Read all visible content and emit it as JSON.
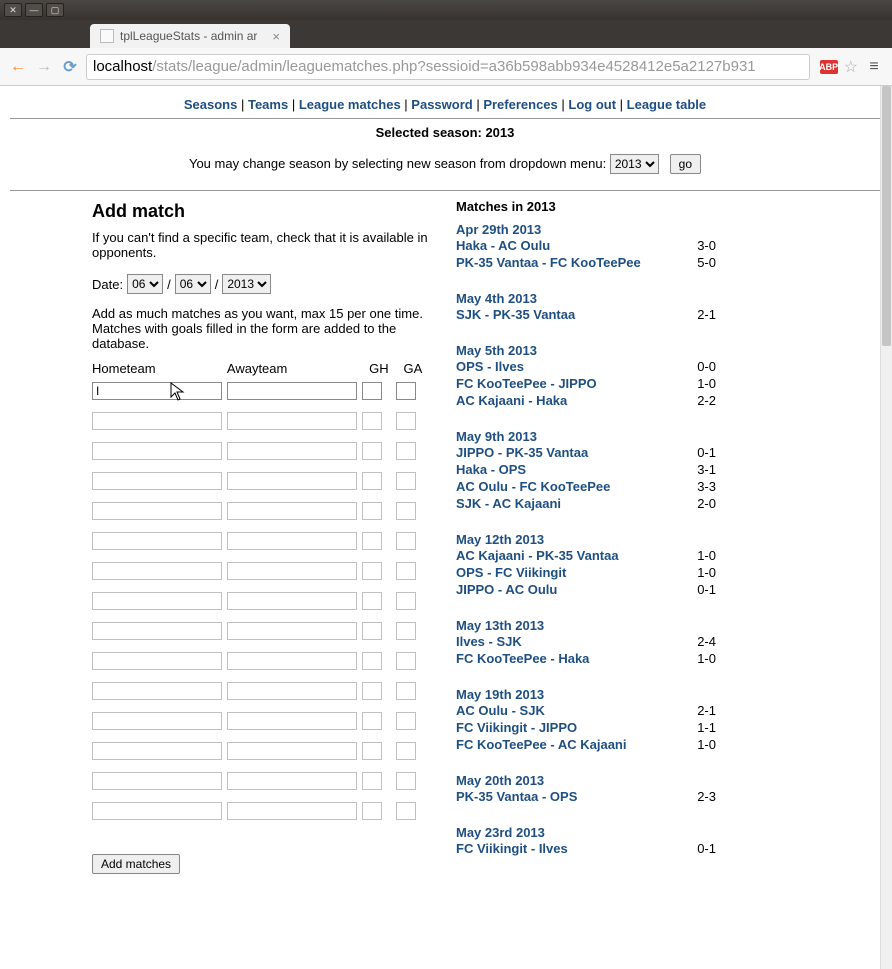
{
  "window": {
    "tab_title": "tplLeagueStats - admin ar",
    "url_host": "localhost",
    "url_path": "/stats/league/admin/leaguematches.php?sessioid=a36b598abb934e4528412e5a2127b931",
    "abp_label": "ABP"
  },
  "nav": {
    "links": [
      "Seasons",
      "Teams",
      "League matches",
      "Password",
      "Preferences",
      "Log out",
      "League table"
    ]
  },
  "season": {
    "selected_label": "Selected season: 2013",
    "change_text": "You may change season by selecting new season from dropdown menu:",
    "dropdown_value": "2013",
    "go_label": "go"
  },
  "addmatch": {
    "heading": "Add match",
    "hint": "If you can't find a specific team, check that it is available in opponents.",
    "date_label": "Date:",
    "day_value": "06",
    "month_value": "06",
    "year_value": "2013",
    "note": "Add as much matches as you want, max 15 per one time. Matches with goals filled in the form are added to the database.",
    "col_home": "Hometeam",
    "col_away": "Awayteam",
    "col_gh": "GH",
    "col_ga": "GA",
    "first_input_value": "I",
    "submit_label": "Add matches",
    "row_count": 15
  },
  "matches": {
    "heading": "Matches in 2013",
    "groups": [
      {
        "date": "Apr 29th 2013",
        "rows": [
          {
            "label": "Haka - AC Oulu",
            "score": "3-0"
          },
          {
            "label": "PK-35 Vantaa - FC KooTeePee",
            "score": "5-0"
          }
        ]
      },
      {
        "date": "May 4th 2013",
        "rows": [
          {
            "label": "SJK - PK-35 Vantaa",
            "score": "2-1"
          }
        ]
      },
      {
        "date": "May 5th 2013",
        "rows": [
          {
            "label": "OPS - Ilves",
            "score": "0-0"
          },
          {
            "label": "FC KooTeePee - JIPPO",
            "score": "1-0"
          },
          {
            "label": "AC Kajaani - Haka",
            "score": "2-2"
          }
        ]
      },
      {
        "date": "May 9th 2013",
        "rows": [
          {
            "label": "JIPPO - PK-35 Vantaa",
            "score": "0-1"
          },
          {
            "label": "Haka - OPS",
            "score": "3-1"
          },
          {
            "label": "AC Oulu - FC KooTeePee",
            "score": "3-3"
          },
          {
            "label": "SJK - AC Kajaani",
            "score": "2-0"
          }
        ]
      },
      {
        "date": "May 12th 2013",
        "rows": [
          {
            "label": "AC Kajaani - PK-35 Vantaa",
            "score": "1-0"
          },
          {
            "label": "OPS - FC Viikingit",
            "score": "1-0"
          },
          {
            "label": "JIPPO - AC Oulu",
            "score": "0-1"
          }
        ]
      },
      {
        "date": "May 13th 2013",
        "rows": [
          {
            "label": "Ilves - SJK",
            "score": "2-4"
          },
          {
            "label": "FC KooTeePee - Haka",
            "score": "1-0"
          }
        ]
      },
      {
        "date": "May 19th 2013",
        "rows": [
          {
            "label": "AC Oulu - SJK",
            "score": "2-1"
          },
          {
            "label": "FC Viikingit - JIPPO",
            "score": "1-1"
          },
          {
            "label": "FC KooTeePee - AC Kajaani",
            "score": "1-0"
          }
        ]
      },
      {
        "date": "May 20th 2013",
        "rows": [
          {
            "label": "PK-35 Vantaa - OPS",
            "score": "2-3"
          }
        ]
      },
      {
        "date": "May 23rd 2013",
        "rows": [
          {
            "label": "FC Viikingit - Ilves",
            "score": "0-1"
          }
        ]
      }
    ]
  }
}
